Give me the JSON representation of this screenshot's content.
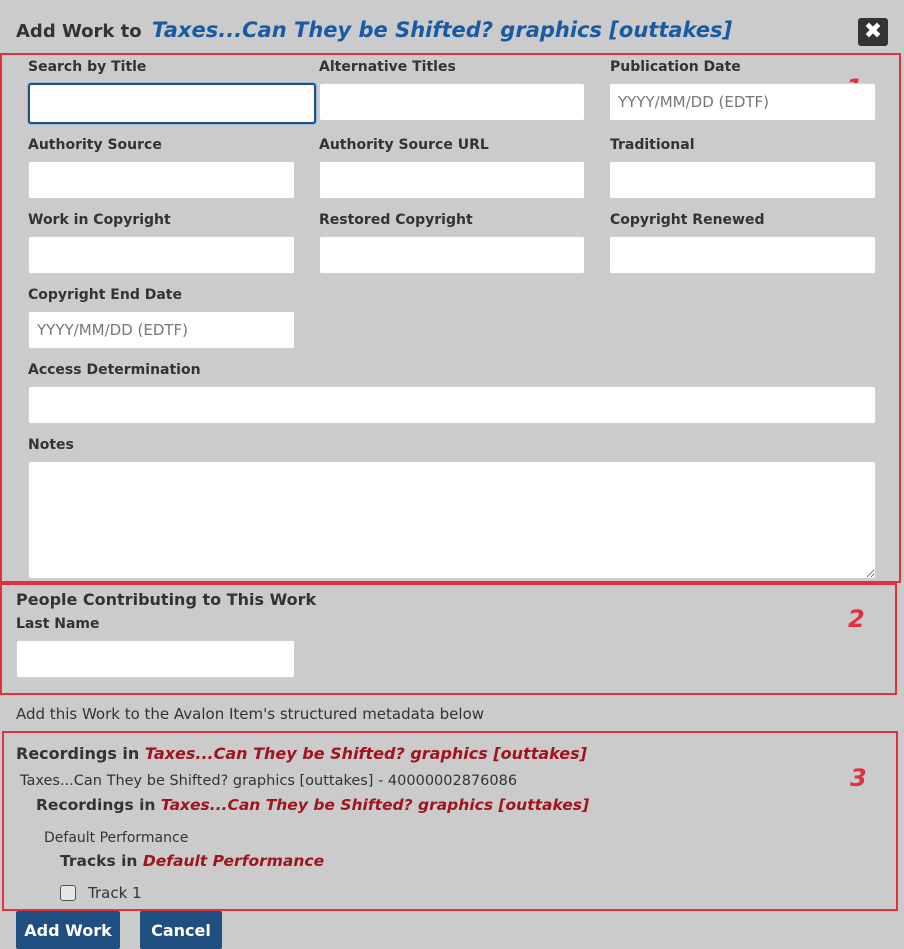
{
  "dialog": {
    "title_prefix": "Add Work to",
    "title_item": "Taxes...Can They be Shifted? graphics [outtakes]",
    "close_symbol": "✖"
  },
  "work_fields": {
    "search_by_title": {
      "label": "Search by Title",
      "value": "",
      "placeholder": ""
    },
    "alternative_titles": {
      "label": "Alternative Titles",
      "value": "",
      "placeholder": ""
    },
    "publication_date": {
      "label": "Publication Date",
      "value": "",
      "placeholder": "YYYY/MM/DD (EDTF)"
    },
    "authority_source": {
      "label": "Authority Source",
      "value": "",
      "placeholder": ""
    },
    "authority_source_url": {
      "label": "Authority Source URL",
      "value": "",
      "placeholder": ""
    },
    "traditional": {
      "label": "Traditional",
      "value": "",
      "placeholder": ""
    },
    "work_in_copyright": {
      "label": "Work in Copyright",
      "value": "",
      "placeholder": ""
    },
    "restored_copyright": {
      "label": "Restored Copyright",
      "value": "",
      "placeholder": ""
    },
    "copyright_renewed": {
      "label": "Copyright Renewed",
      "value": "",
      "placeholder": ""
    },
    "copyright_end_date": {
      "label": "Copyright End Date",
      "value": "",
      "placeholder": "YYYY/MM/DD (EDTF)"
    },
    "access_determination": {
      "label": "Access Determination",
      "value": "",
      "placeholder": ""
    },
    "notes": {
      "label": "Notes",
      "value": "",
      "placeholder": ""
    }
  },
  "people": {
    "heading": "People Contributing to This Work",
    "last_name_label": "Last Name",
    "last_name_value": ""
  },
  "instructions": "Add this Work to the Avalon Item's structured metadata below",
  "recordings": {
    "heading_prefix": "Recordings in",
    "heading_item": "Taxes...Can They be Shifted? graphics [outtakes]",
    "item_line": "Taxes...Can They be Shifted? graphics [outtakes] - 40000002876086",
    "sub_heading_prefix": "Recordings in",
    "sub_heading_item": "Taxes...Can They be Shifted? graphics [outtakes]",
    "performance": "Default Performance",
    "tracks_prefix": "Tracks in",
    "tracks_item": "Default Performance",
    "tracks": [
      {
        "label": "Track 1",
        "checked": false
      }
    ]
  },
  "annotations": {
    "region_1": "1",
    "region_2": "2",
    "region_3": "3",
    "color": "#e0323c"
  },
  "buttons": {
    "add_work": "Add Work",
    "cancel": "Cancel"
  }
}
